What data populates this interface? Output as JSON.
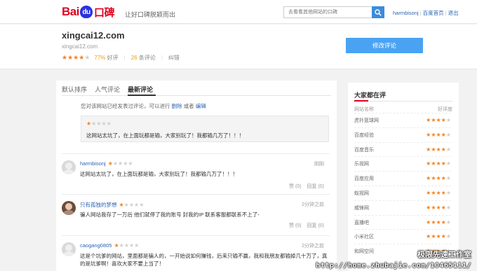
{
  "topbar": {
    "logo": {
      "bai": "Bai",
      "du": "du",
      "cn": "口碑"
    },
    "slogan": "让好口碑脱颖而出",
    "search_placeholder": "去看看其他网站的口碑",
    "user": "harmbisonj",
    "home": "百度首页",
    "logout": "退出"
  },
  "site": {
    "name": "xingcai12.com",
    "url": "xingcai12.com",
    "rating": 4,
    "percent": "77%",
    "percent_label": "好评",
    "count": "26",
    "count_label": "条评论",
    "report": "纠错",
    "edit_button": "修改评论"
  },
  "tabs": [
    {
      "label": "默认排序",
      "active": false
    },
    {
      "label": "人气评论",
      "active": false
    },
    {
      "label": "最新评论",
      "active": true
    }
  ],
  "notice": {
    "text": "您对该网站已经发表过评论，可以进行",
    "delete": "删除",
    "or": "或者",
    "edit": "编辑"
  },
  "my_comment": {
    "rating": 1,
    "text": "这网站太坑了，在上面玩都是输，大家别玩了！我都输几万了！！！"
  },
  "comments": [
    {
      "user": "harmbisonj",
      "rating": 1,
      "time": "刚刚",
      "text": "这网站太坑了，在上面玩都是输，大家别玩了！我都输几万了！！！",
      "like": "赞 (0)",
      "reply": "回复 (0)"
    },
    {
      "user": "只有孤独的梦想",
      "rating": 1,
      "time": "2分钟之前",
      "text": "骗人网站我存了一万后 他们就停了我的账号 封我的IP 联系客服都联系不上了-",
      "like": "赞 (0)",
      "reply": "回复 (0)"
    },
    {
      "user": "caogang0805",
      "rating": 1,
      "time": "2分钟之前",
      "text": "这是个坑爹的网站，里面都是骗人的，一开始说如何赚钱，后来只输不赢，我和我朋友都输掉几十万了，真的是坑爹啊！喜欢大家不要上当了！",
      "like": "",
      "reply": ""
    }
  ],
  "sidebar": {
    "title": "大家都在评",
    "col_name": "网站名称",
    "col_rating": "好评度",
    "items": [
      {
        "name": "虎扑篮球网",
        "rating": 4
      },
      {
        "name": "百度经验",
        "rating": 4
      },
      {
        "name": "百度音乐",
        "rating": 4
      },
      {
        "name": "乐视网",
        "rating": 4
      },
      {
        "name": "百度应用",
        "rating": 4
      },
      {
        "name": "蚁视网",
        "rating": 4
      },
      {
        "name": "威锋网",
        "rating": 4
      },
      {
        "name": "直播吧",
        "rating": 4
      },
      {
        "name": "小米社区",
        "rating": 4
      },
      {
        "name": "和网空间",
        "rating": 4
      }
    ]
  },
  "watermark": {
    "line1": "极限先速工作室",
    "line2": "http://home.zhubajie.com/10465111/"
  },
  "colors": {
    "accent": "#4aa3f2",
    "star": "#f5821f",
    "brand_red": "#e1001e",
    "brand_blue": "#2932e1",
    "link": "#2d64b3"
  }
}
